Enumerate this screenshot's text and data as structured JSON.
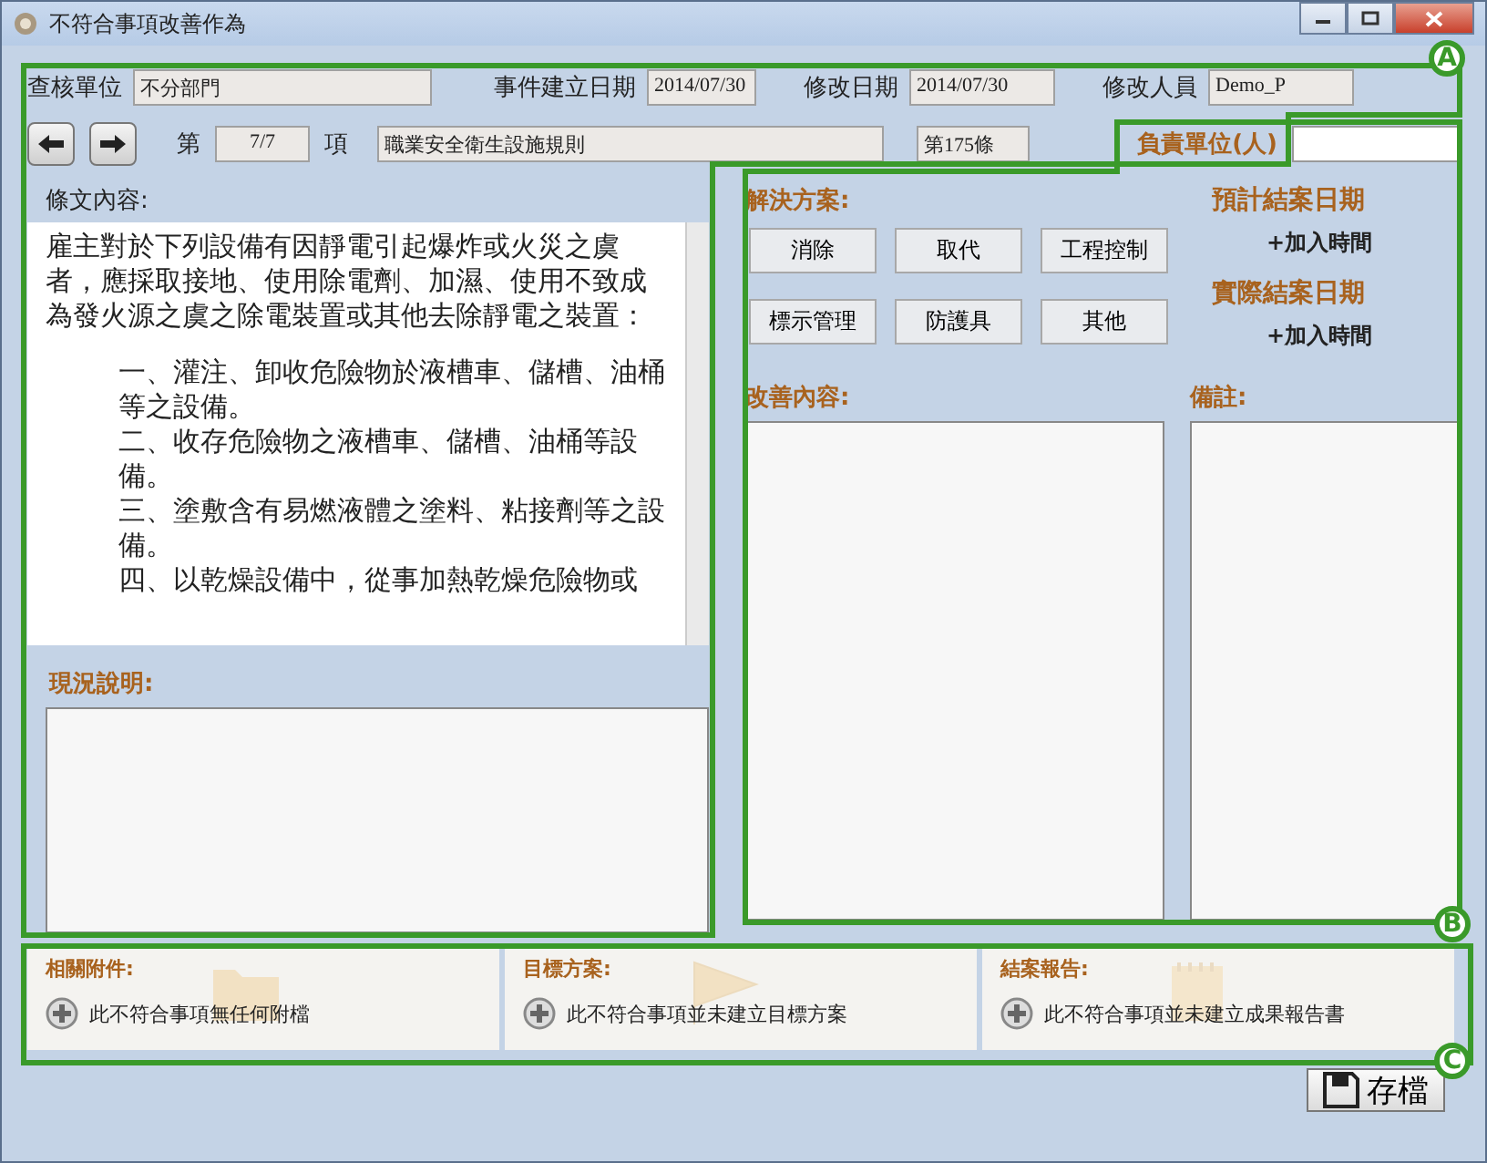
{
  "window": {
    "title": "不符合事項改善作為"
  },
  "header": {
    "fields": [
      {
        "label": "查核單位",
        "value": "不分部門"
      },
      {
        "label": "事件建立日期",
        "value": "2014/07/30"
      },
      {
        "label": "修改日期",
        "value": "2014/07/30"
      },
      {
        "label": "修改人員",
        "value": "Demo_P"
      }
    ],
    "item_prefix": "第",
    "item_value": "7/7",
    "item_suffix": "項",
    "regulation": "職業安全衛生設施規則",
    "article": "第175條",
    "responsible_label": "負責單位(人)"
  },
  "article_content": {
    "label": "條文內容:",
    "paragraphs": [
      {
        "kind": "main",
        "text": "雇主對於下列設備有因靜電引起爆炸或火災之虞者，應採取接地、使用除電劑、加濕、使用不致成為發火源之虞之除電裝置或其他去除靜電之裝置："
      },
      {
        "kind": "item",
        "text": "一、灌注、卸收危險物於液槽車、儲槽、油桶等之設備。"
      },
      {
        "kind": "item",
        "text": "二、收存危險物之液槽車、儲槽、油桶等設備。"
      },
      {
        "kind": "item",
        "text": "三、塗敷含有易燃液體之塗料、粘接劑等之設備。"
      },
      {
        "kind": "item",
        "text": "四、以乾燥設備中，從事加熱乾燥危險物或"
      }
    ]
  },
  "situation": {
    "label": "現況說明:"
  },
  "solutions": {
    "label": "解決方案:",
    "buttons": [
      "消除",
      "取代",
      "工程控制",
      "標示管理",
      "防護具",
      "其他"
    ]
  },
  "dates": [
    {
      "label": "預計結案日期",
      "action": "+加入時間"
    },
    {
      "label": "實際結案日期",
      "action": "+加入時間"
    }
  ],
  "improvement": {
    "label": "改善內容:"
  },
  "remarks": {
    "label": "備註:"
  },
  "footer": [
    {
      "kind": "folder",
      "label": "相關附件:",
      "text": "此不符合事項無任何附檔"
    },
    {
      "kind": "flag",
      "label": "目標方案:",
      "text": "此不符合事項並未建立目標方案"
    },
    {
      "kind": "notepad",
      "label": "結案報告:",
      "text": "此不符合事項並未建立成果報告書"
    }
  ],
  "save_button": "存檔",
  "annotations": [
    "A",
    "B",
    "C"
  ]
}
